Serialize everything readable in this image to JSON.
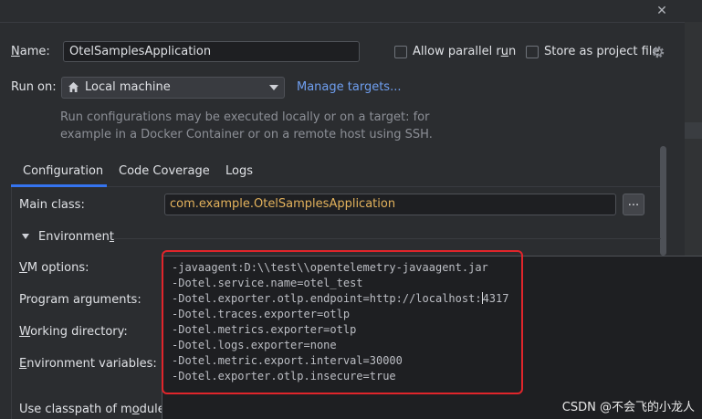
{
  "dialog": {
    "close_glyph": "✕"
  },
  "name_row": {
    "label_prefix": "N",
    "label_rest": "ame:",
    "value": "OtelSamplesApplication",
    "allow_parallel_label_a": "Allow parallel r",
    "allow_parallel_label_u": "u",
    "allow_parallel_label_b": "n",
    "store_label": "Store as project file",
    "gear_icon": "gear-icon"
  },
  "run_on": {
    "label": "Run on:",
    "target_value": "Local machine",
    "home_icon": "home-icon",
    "manage_link": "Manage targets..."
  },
  "hint": {
    "line1": "Run configurations may be executed locally or on a target: for",
    "line2": "example in a Docker Container or on a remote host using SSH."
  },
  "tabs": [
    {
      "label": "Configuration",
      "active": true
    },
    {
      "label": "Code Coverage",
      "active": false
    },
    {
      "label": "Logs",
      "active": false
    }
  ],
  "main_class": {
    "label": "Main class:",
    "value": "com.example.OtelSamplesApplication",
    "browse_label": "..."
  },
  "environment": {
    "label_a": "Environmen",
    "label_u": "t"
  },
  "fields": {
    "vm_options_u": "V",
    "vm_options_rest": "M options:",
    "program_args": "Program arguments:",
    "working_dir_u": "W",
    "working_dir_rest": "orking directory:",
    "env_vars_u": "E",
    "env_vars_rest": "nvironment variables:",
    "classpath_a": "Use classpath of m",
    "classpath_u": "o",
    "classpath_b": "dule:"
  },
  "vm_options_lines": [
    "-javaagent:D:\\\\test\\\\opentelemetry-javaagent.jar",
    "-Dotel.service.name=otel_test",
    "-Dotel.exporter.otlp.endpoint=http://localhost:",
    "4317",
    "-Dotel.traces.exporter=otlp",
    "-Dotel.metrics.exporter=otlp",
    "-Dotel.logs.exporter=none",
    "-Dotel.metric.export.interval=30000",
    "-Dotel.exporter.otlp.insecure=true"
  ],
  "watermark": "CSDN @不会飞的小龙人",
  "colors": {
    "accent": "#3574f0",
    "link": "#6f9ff0",
    "highlight_border": "#e0252b",
    "class_value": "#e3b25c"
  }
}
